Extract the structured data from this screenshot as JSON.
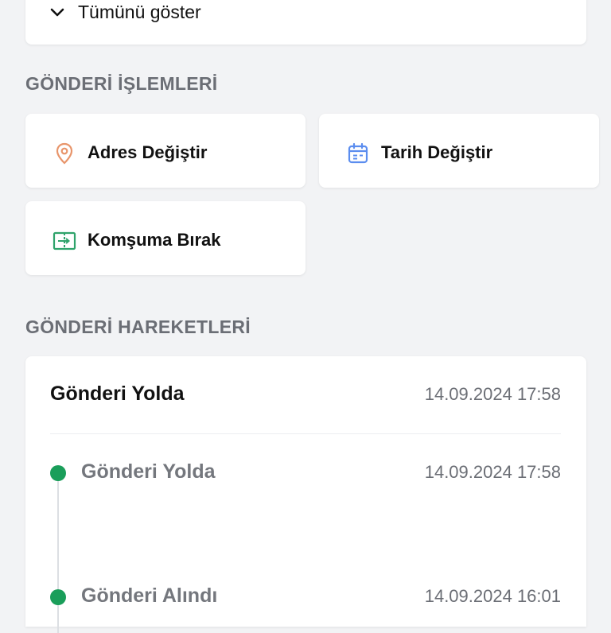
{
  "show_all": {
    "label": "Tümünü göster"
  },
  "actions_section": {
    "title": "GÖNDERİ İŞLEMLERİ",
    "items": [
      {
        "label": "Adres Değiştir",
        "icon": "location-pin-icon",
        "color": "#e8956b"
      },
      {
        "label": "Tarih Değiştir",
        "icon": "calendar-icon",
        "color": "#5b8def"
      },
      {
        "label": "Komşuma Bırak",
        "icon": "neighbor-transfer-icon",
        "color": "#2fa36b"
      }
    ]
  },
  "history_section": {
    "title": "GÖNDERİ HAREKETLERİ",
    "current": {
      "status": "Gönderi Yolda",
      "date": "14.09.2024 17:58"
    },
    "events": [
      {
        "status": "Gönderi Yolda",
        "date": "14.09.2024 17:58"
      },
      {
        "status": "Gönderi Alındı",
        "date": "14.09.2024 16:01"
      }
    ],
    "dot_color": "#1a9e5a"
  }
}
